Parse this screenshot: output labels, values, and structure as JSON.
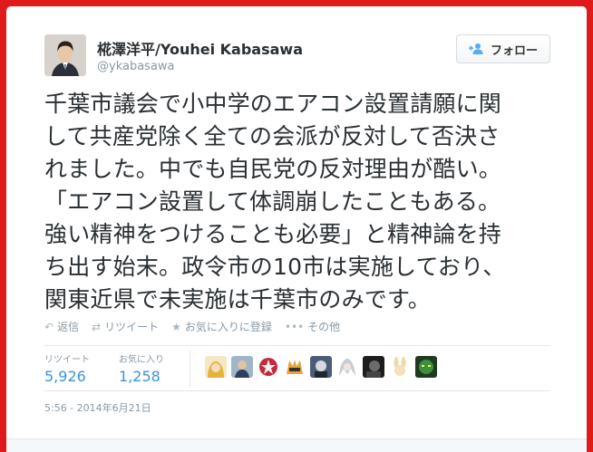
{
  "user": {
    "display_name": "椛澤洋平/Youhei Kabasawa",
    "handle": "@ykabasawa"
  },
  "follow_button": {
    "label": "フォロー",
    "icon": "person-add-icon"
  },
  "tweet": {
    "text": "千葉市議会で小中学のエアコン設置請願に関\nして共産党除く全ての会派が反対して否決さ\nれました。中でも自民党の反対理由が酷い。\n「エアコン設置して体調崩したこともある。\n強い精神をつけることも必要」と精神論を持\nち出す始末。政令市の10市は実施しており、\n関東近県で未実施は千葉市のみです。"
  },
  "actions": [
    {
      "icon": "reply-icon",
      "label": "返信"
    },
    {
      "icon": "retweet-icon",
      "label": "リツイート"
    },
    {
      "icon": "star-icon",
      "label": "お気に入りに登録"
    },
    {
      "icon": "more-icon",
      "label": "その他"
    }
  ],
  "stats": {
    "retweets": {
      "label": "リツイート",
      "value": "5,926"
    },
    "favorites": {
      "label": "お気に入り",
      "value": "1,258"
    }
  },
  "timestamp": "5:56 - 2014年6月21日",
  "colors": {
    "background": "#e0191b",
    "link": "#3b94d9",
    "muted": "#8899a6",
    "text": "#292f33"
  }
}
